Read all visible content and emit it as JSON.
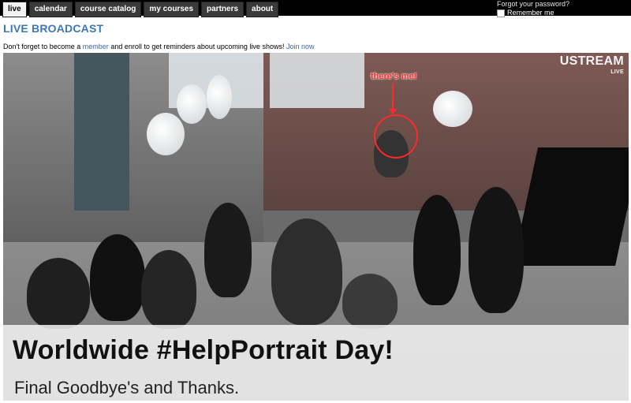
{
  "nav": {
    "tabs": [
      {
        "label": "live",
        "active": true
      },
      {
        "label": "calendar"
      },
      {
        "label": "course catalog"
      },
      {
        "label": "my courses"
      },
      {
        "label": "partners"
      },
      {
        "label": "about"
      }
    ]
  },
  "login": {
    "forgot_password": "Forgot your password?",
    "remember_me": "Remember me"
  },
  "page": {
    "title": "LIVE BROADCAST",
    "notice_prefix": "Don't forget to become a",
    "notice_member_link": "member",
    "notice_middle": "and enroll to get reminders about upcoming live shows!",
    "notice_join_link": "Join now"
  },
  "video": {
    "brand": "USTREAM",
    "brand_sub": "LIVE",
    "annotation": "there's me!",
    "banner_title": "Worldwide #HelpPortrait Day!",
    "banner_subtitle": "Final Goodbye's and Thanks."
  },
  "colors": {
    "title": "#3d78b6",
    "link": "#3b67a8",
    "annotation": "#ff2a2a"
  }
}
